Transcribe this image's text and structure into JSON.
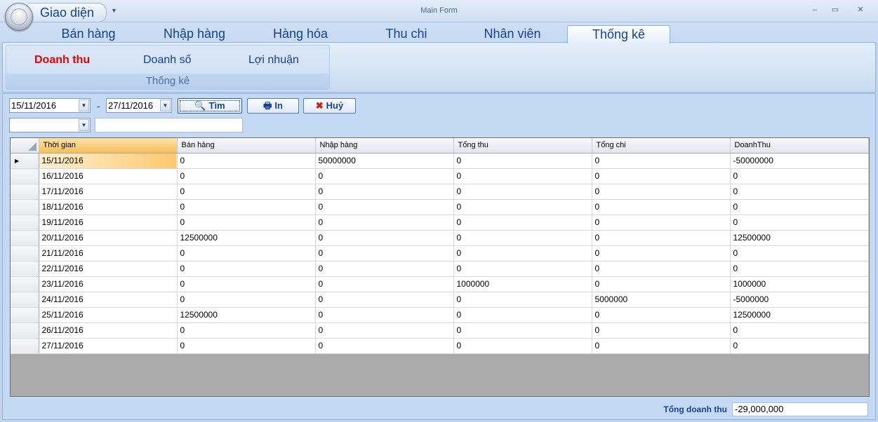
{
  "window": {
    "title": "Main Form",
    "quick_access_label": "Giao diện",
    "controls": {
      "minimize": "–",
      "maximize": "▭",
      "close": "✕"
    }
  },
  "tabs": [
    {
      "label": "Bán hàng",
      "active": false
    },
    {
      "label": "Nhập hàng",
      "active": false
    },
    {
      "label": "Hàng hóa",
      "active": false
    },
    {
      "label": "Thu chi",
      "active": false
    },
    {
      "label": "Nhân viên",
      "active": false
    },
    {
      "label": "Thống kê",
      "active": true
    }
  ],
  "ribbon": {
    "group_label": "Thống kê",
    "buttons": [
      {
        "label": "Doanh thu",
        "active": true
      },
      {
        "label": "Doanh số",
        "active": false
      },
      {
        "label": "Lợi nhuận",
        "active": false
      }
    ]
  },
  "filter": {
    "from_date": "15/11/2016",
    "separator": "-",
    "to_date": "27/11/2016",
    "search_label": "Tìm",
    "print_label": "In",
    "cancel_label": "Huỷ",
    "combo_value": "",
    "text_value": ""
  },
  "grid": {
    "columns": [
      "Thời gian",
      "Bán hàng",
      "Nhập hàng",
      "Tổng thu",
      "Tổng chi",
      "DoanhThu"
    ],
    "current_row_marker": "▶",
    "rows": [
      [
        "15/11/2016",
        "0",
        "50000000",
        "0",
        "0",
        "-50000000"
      ],
      [
        "16/11/2016",
        "0",
        "0",
        "0",
        "0",
        "0"
      ],
      [
        "17/11/2016",
        "0",
        "0",
        "0",
        "0",
        "0"
      ],
      [
        "18/11/2016",
        "0",
        "0",
        "0",
        "0",
        "0"
      ],
      [
        "19/11/2016",
        "0",
        "0",
        "0",
        "0",
        "0"
      ],
      [
        "20/11/2016",
        "12500000",
        "0",
        "0",
        "0",
        "12500000"
      ],
      [
        "21/11/2016",
        "0",
        "0",
        "0",
        "0",
        "0"
      ],
      [
        "22/11/2016",
        "0",
        "0",
        "0",
        "0",
        "0"
      ],
      [
        "23/11/2016",
        "0",
        "0",
        "1000000",
        "0",
        "1000000"
      ],
      [
        "24/11/2016",
        "0",
        "0",
        "0",
        "5000000",
        "-5000000"
      ],
      [
        "25/11/2016",
        "12500000",
        "0",
        "0",
        "0",
        "12500000"
      ],
      [
        "26/11/2016",
        "0",
        "0",
        "0",
        "0",
        "0"
      ],
      [
        "27/11/2016",
        "0",
        "0",
        "0",
        "0",
        "0"
      ]
    ]
  },
  "summary": {
    "label": "Tổng doanh thu",
    "value": "-29,000,000"
  }
}
